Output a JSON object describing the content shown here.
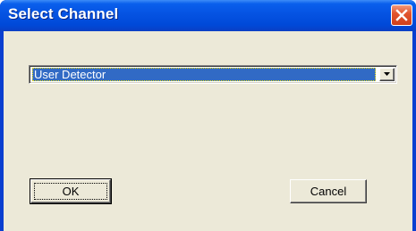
{
  "window": {
    "title": "Select Channel",
    "close_icon": "close-x-icon"
  },
  "channel_select": {
    "selected_value": "User Detector",
    "arrow_icon": "chevron-down-icon"
  },
  "buttons": {
    "ok_label": "OK",
    "cancel_label": "Cancel"
  },
  "colors": {
    "titlebar": "#0553e2",
    "dialog_face": "#ece9d8",
    "selection": "#316ac5",
    "close_button": "#e2552f"
  }
}
